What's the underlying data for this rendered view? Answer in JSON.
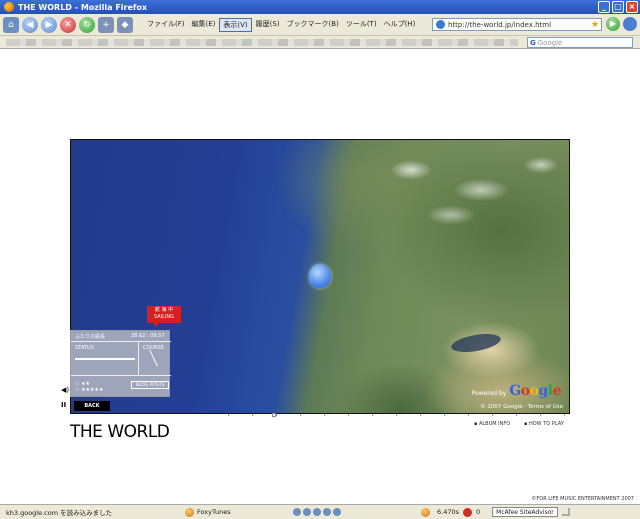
{
  "window": {
    "title": "THE WORLD - Mozilla Firefox",
    "minimize": "_",
    "maximize": "□",
    "close": "×"
  },
  "toolbar": {
    "menus": [
      {
        "label": "ファイル(F)",
        "active": false
      },
      {
        "label": "編集(E)",
        "active": false
      },
      {
        "label": "表示(V)",
        "active": true
      },
      {
        "label": "履歴(S)",
        "active": false
      },
      {
        "label": "ブックマーク(B)",
        "active": false
      },
      {
        "label": "ツール(T)",
        "active": false
      },
      {
        "label": "ヘルプ(H)",
        "active": false
      }
    ],
    "url": "http://the-world.jp/index.html",
    "go_label": "▶"
  },
  "bookmarks": {
    "search_placeholder": "Google",
    "search_engine_glyph": "G"
  },
  "map": {
    "powered_by": "Powered by",
    "copyright": "© 2007 Google · Terms of Use"
  },
  "overlay": {
    "now_badge_line1": "航 海 中",
    "now_badge_line2": "SAILING",
    "panel_ship": "ふたりの船長",
    "panel_time": "28.62 : 09.57",
    "panel_status": "STATUS",
    "panel_course": "COURSE",
    "stars_line1": "☆ ★★",
    "stars_line2": "☆ ★★★★★",
    "blog_button": "BLOG POSTS",
    "back_button": "BACK",
    "volume_glyph": "◀)",
    "pause_glyph": "II"
  },
  "page": {
    "site_title": "THE WORLD",
    "album_info": "▪ ALBUM INFO",
    "how_to_play": "▪ HOW TO PLAY",
    "footer_copyright": "©FOR LIFE MUSIC ENTERTAINMENT 2007"
  },
  "statusbar": {
    "status_text": "kh3.google.com を読み込みました",
    "foxytunes": "FoxyTunes",
    "timer": "6.470s",
    "count": "0",
    "mcafee": "McAfee SiteAdvisor"
  }
}
